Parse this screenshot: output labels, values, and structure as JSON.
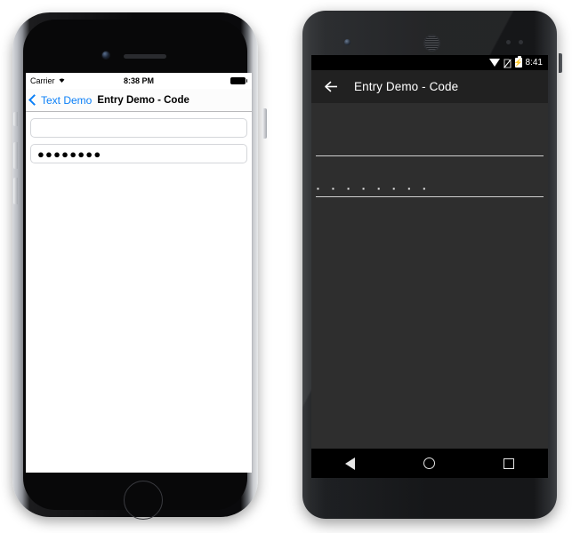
{
  "ios": {
    "status_bar": {
      "carrier": "Carrier",
      "wifi_icon": "wifi-icon",
      "time": "8:38 PM",
      "battery_icon": "battery-full-icon"
    },
    "nav_bar": {
      "back_chevron_icon": "chevron-left-icon",
      "back_label": "Text Demo",
      "title": "Entry Demo - Code",
      "back_color": "#0b7ff7"
    },
    "entries": [
      {
        "name": "entry-plain",
        "value": "",
        "placeholder": ""
      },
      {
        "name": "entry-password",
        "value": "●●●●●●●●",
        "placeholder": ""
      }
    ],
    "home_button_icon": "home-button-icon"
  },
  "android": {
    "status_bar": {
      "wifi_icon": "wifi-icon",
      "no_sim_icon": "no-sim-icon",
      "battery_icon": "battery-charging-icon",
      "time": "8:41"
    },
    "app_bar": {
      "back_arrow_icon": "arrow-left-icon",
      "title": "Entry Demo - Code",
      "background": "#212121"
    },
    "entries": [
      {
        "name": "entry-plain",
        "value": "",
        "placeholder": ""
      },
      {
        "name": "entry-password",
        "value": "▪ ▪ ▪ ▪ ▪ ▪ ▪ ▪",
        "placeholder": ""
      }
    ],
    "nav_bar": {
      "back_icon": "triangle-back-icon",
      "home_icon": "circle-home-icon",
      "recents_icon": "square-recents-icon"
    },
    "content_background": "#2e2e2e"
  }
}
